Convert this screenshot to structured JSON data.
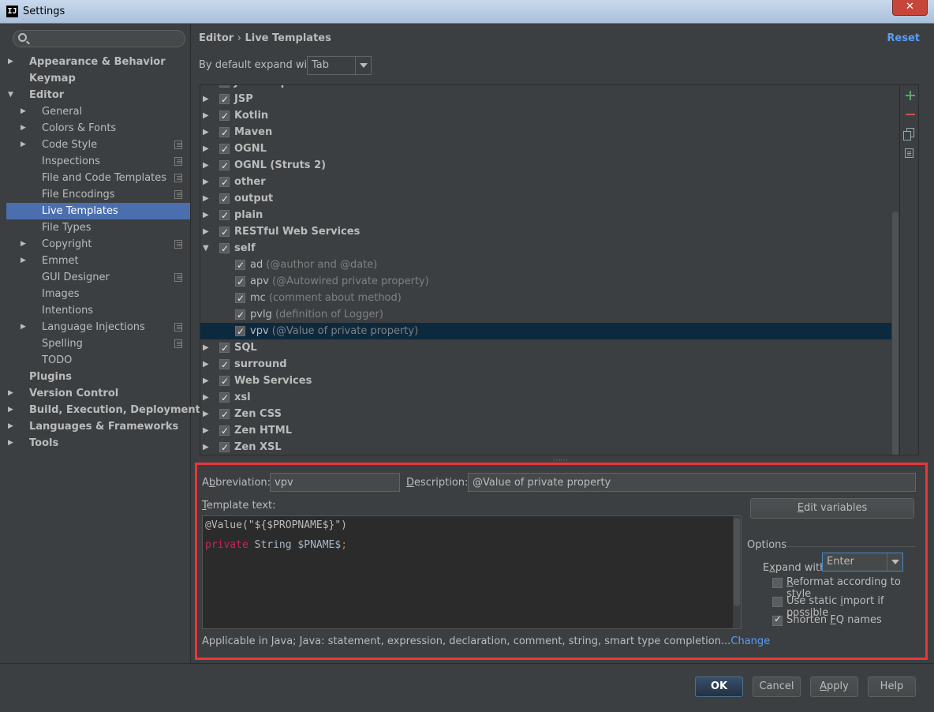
{
  "window": {
    "title": "Settings",
    "app_icon": "IJ",
    "close_label": "✕"
  },
  "search": {
    "placeholder": ""
  },
  "nav": [
    {
      "label": "Appearance & Behavior",
      "level": 0,
      "arrow": "right",
      "bold": true
    },
    {
      "label": "Keymap",
      "level": 0,
      "arrow": "none",
      "bold": true
    },
    {
      "label": "Editor",
      "level": 0,
      "arrow": "down",
      "bold": true
    },
    {
      "label": "General",
      "level": 1,
      "arrow": "right"
    },
    {
      "label": "Colors & Fonts",
      "level": 1,
      "arrow": "right"
    },
    {
      "label": "Code Style",
      "level": 1,
      "arrow": "right",
      "icon": true
    },
    {
      "label": "Inspections",
      "level": 1,
      "arrow": "none",
      "icon": true
    },
    {
      "label": "File and Code Templates",
      "level": 1,
      "arrow": "none",
      "icon": true
    },
    {
      "label": "File Encodings",
      "level": 1,
      "arrow": "none",
      "icon": true
    },
    {
      "label": "Live Templates",
      "level": 1,
      "arrow": "none",
      "selected": true
    },
    {
      "label": "File Types",
      "level": 1,
      "arrow": "none"
    },
    {
      "label": "Copyright",
      "level": 1,
      "arrow": "right",
      "icon": true
    },
    {
      "label": "Emmet",
      "level": 1,
      "arrow": "right"
    },
    {
      "label": "GUI Designer",
      "level": 1,
      "arrow": "none",
      "icon": true
    },
    {
      "label": "Images",
      "level": 1,
      "arrow": "none"
    },
    {
      "label": "Intentions",
      "level": 1,
      "arrow": "none"
    },
    {
      "label": "Language Injections",
      "level": 1,
      "arrow": "right",
      "icon": true
    },
    {
      "label": "Spelling",
      "level": 1,
      "arrow": "none",
      "icon": true
    },
    {
      "label": "TODO",
      "level": 1,
      "arrow": "none"
    },
    {
      "label": "Plugins",
      "level": 0,
      "arrow": "none",
      "bold": true
    },
    {
      "label": "Version Control",
      "level": 0,
      "arrow": "right",
      "bold": true
    },
    {
      "label": "Build, Execution, Deployment",
      "level": 0,
      "arrow": "right",
      "bold": true
    },
    {
      "label": "Languages & Frameworks",
      "level": 0,
      "arrow": "right",
      "bold": true
    },
    {
      "label": "Tools",
      "level": 0,
      "arrow": "right",
      "bold": true
    }
  ],
  "header": {
    "breadcrumb_parent": "Editor",
    "breadcrumb_sep": "›",
    "breadcrumb_current": "Live Templates",
    "reset_label": "Reset"
  },
  "expand_default": {
    "label": "By default expand with",
    "value": "Tab"
  },
  "template_tree": [
    {
      "type": "group",
      "name": "JavaScript",
      "expanded": false,
      "checked": true
    },
    {
      "type": "group",
      "name": "JSP",
      "expanded": false,
      "checked": true
    },
    {
      "type": "group",
      "name": "Kotlin",
      "expanded": false,
      "checked": true
    },
    {
      "type": "group",
      "name": "Maven",
      "expanded": false,
      "checked": true
    },
    {
      "type": "group",
      "name": "OGNL",
      "expanded": false,
      "checked": true
    },
    {
      "type": "group",
      "name": "OGNL (Struts 2)",
      "expanded": false,
      "checked": true
    },
    {
      "type": "group",
      "name": "other",
      "expanded": false,
      "checked": true
    },
    {
      "type": "group",
      "name": "output",
      "expanded": false,
      "checked": true
    },
    {
      "type": "group",
      "name": "plain",
      "expanded": false,
      "checked": true
    },
    {
      "type": "group",
      "name": "RESTful Web Services",
      "expanded": false,
      "checked": true
    },
    {
      "type": "group",
      "name": "self",
      "expanded": true,
      "checked": true
    },
    {
      "type": "item",
      "name": "ad",
      "desc": "(@author and @date)",
      "checked": true
    },
    {
      "type": "item",
      "name": "apv",
      "desc": "(@Autowired private property)",
      "checked": true
    },
    {
      "type": "item",
      "name": "mc",
      "desc": "(comment about method)",
      "checked": true
    },
    {
      "type": "item",
      "name": "pvlg",
      "desc": "(definition of Logger)",
      "checked": true
    },
    {
      "type": "item",
      "name": "vpv",
      "desc": "(@Value of private property)",
      "checked": true,
      "selected": true
    },
    {
      "type": "group",
      "name": "SQL",
      "expanded": false,
      "checked": true
    },
    {
      "type": "group",
      "name": "surround",
      "expanded": false,
      "checked": true
    },
    {
      "type": "group",
      "name": "Web Services",
      "expanded": false,
      "checked": true
    },
    {
      "type": "group",
      "name": "xsl",
      "expanded": false,
      "checked": true
    },
    {
      "type": "group",
      "name": "Zen CSS",
      "expanded": false,
      "checked": true
    },
    {
      "type": "group",
      "name": "Zen HTML",
      "expanded": false,
      "checked": true
    },
    {
      "type": "group",
      "name": "Zen XSL",
      "expanded": false,
      "checked": true
    }
  ],
  "tree_tools": [
    "plus-icon",
    "minus-icon",
    "copy-icon",
    "paste-icon"
  ],
  "editor": {
    "abbr_label_pre": "A",
    "abbr_label_u": "b",
    "abbr_label_post": "breviation:",
    "abbr_value": "vpv",
    "desc_label_u": "D",
    "desc_label_post": "escription:",
    "desc_value": "@Value of private property",
    "template_label_u": "T",
    "template_label_post": "emplate text:",
    "code_line1": "@Value(\"${$PROPNAME$}\")",
    "code_line2_kw": "private",
    "code_line2_rest": " String $PNAME$",
    "code_line2_semi": ";",
    "edit_vars_label_u": "E",
    "edit_vars_label_post": "dit variables",
    "options_label": "Options",
    "expand_with_label_pre": "E",
    "expand_with_label_u": "x",
    "expand_with_label_post": "pand with",
    "expand_with_value": "Enter",
    "opt_reformat_u": "R",
    "opt_reformat_post": "eformat according to style",
    "opt_reformat_checked": false,
    "opt_static_pre": "Use static ",
    "opt_static_u": "i",
    "opt_static_post": "mport if possible",
    "opt_static_checked": false,
    "opt_shorten_pre": "Shorten ",
    "opt_shorten_u": "F",
    "opt_shorten_post": "Q names",
    "opt_shorten_checked": true,
    "applicable_text": "Applicable in Java; Java: statement, expression, declaration, comment, string, smart type completion...",
    "change_label": "Change"
  },
  "footer": {
    "ok": "OK",
    "cancel": "Cancel",
    "apply_u": "A",
    "apply_post": "pply",
    "help": "Help"
  },
  "colors": {
    "accent": "#589df6",
    "selection": "#4b6eaf",
    "highlight_border": "#e8373a"
  }
}
